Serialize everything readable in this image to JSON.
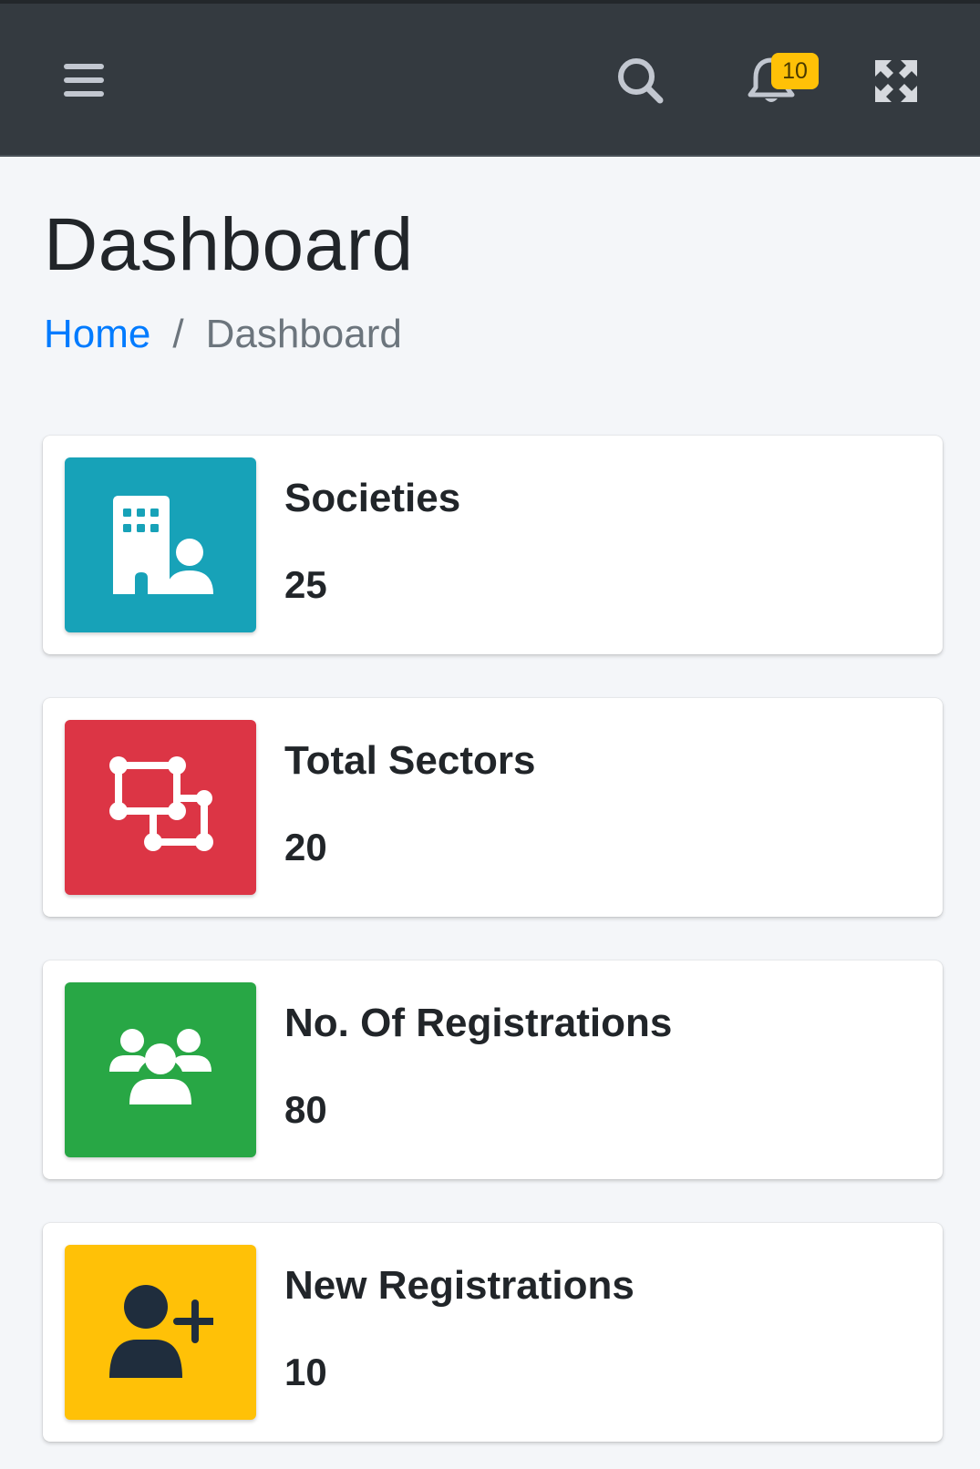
{
  "navbar": {
    "notification_count": "10"
  },
  "page": {
    "title": "Dashboard"
  },
  "breadcrumb": {
    "home": "Home",
    "separator": "/",
    "current": "Dashboard"
  },
  "cards": [
    {
      "label": "Societies",
      "value": "25",
      "icon": "building-user-icon",
      "color": "#17a2b8"
    },
    {
      "label": "Total Sectors",
      "value": "20",
      "icon": "vector-square-icon",
      "color": "#dc3545"
    },
    {
      "label": "No. Of Registrations",
      "value": "80",
      "icon": "users-icon",
      "color": "#28a745"
    },
    {
      "label": "New Registrations",
      "value": "10",
      "icon": "user-plus-icon",
      "color": "#ffc107"
    }
  ]
}
